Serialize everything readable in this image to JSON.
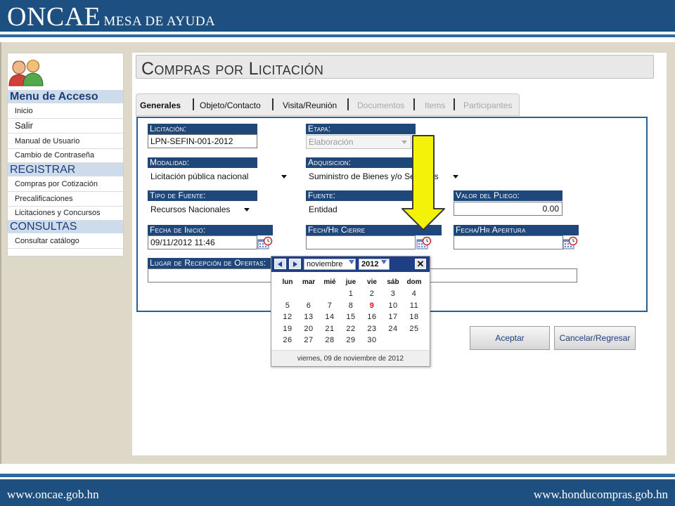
{
  "header": {
    "brand_big": "ONCAE",
    "brand_small": "MESA DE AYUDA"
  },
  "footer": {
    "url_left": "www.oncae.gob.hn",
    "url_right": "www.honducompras.gob.hn"
  },
  "menu": {
    "icon": "users-icon",
    "heading_access": "Menu de Acceso",
    "heading_register": "REGISTRAR",
    "heading_consult": "CONSULTAS",
    "items_access": [
      "Inicio",
      "Salir",
      "Manual de Usuario",
      "Cambio de Contraseña"
    ],
    "items_register": [
      "Compras por Cotización",
      "Precalificaciones",
      "Licitaciones y Concursos"
    ],
    "items_consult": [
      "Consultar catálogo"
    ]
  },
  "page": {
    "title": "Compras por Licitación"
  },
  "tabs": [
    {
      "label": "Generales",
      "state": "active"
    },
    {
      "label": "Objeto/Contacto",
      "state": "normal"
    },
    {
      "label": "Visita/Reunión",
      "state": "normal"
    },
    {
      "label": "Documentos",
      "state": "disabled"
    },
    {
      "label": "Items",
      "state": "disabled"
    },
    {
      "label": "Participantes",
      "state": "disabled"
    }
  ],
  "form": {
    "licitacion": {
      "label": "Licitación:",
      "value": "LPN-SEFIN-001-2012"
    },
    "etapa": {
      "label": "Etapa:",
      "value": "Elaboración"
    },
    "modalidad": {
      "label": "Modalidad:",
      "value": "Licitación pública nacional"
    },
    "adquisicion": {
      "label": "Adquisicion:",
      "value": "Suministro de Bienes y/o Servicios"
    },
    "tipo_fuente": {
      "label": "Tipo de Fuente:",
      "value": "Recursos Nacionales"
    },
    "fuente": {
      "label": "Fuente:",
      "value": "Entidad"
    },
    "valor_pliego": {
      "label": "Valor del Pliego:",
      "value": "0.00"
    },
    "fecha_inicio": {
      "label": "Fecha de Inicio:",
      "value": "09/11/2012 11:46"
    },
    "fech_cierre": {
      "label": "Fech/Hr Cierre",
      "value": ""
    },
    "fecha_apertura": {
      "label": "Fecha/Hr Apertura",
      "value": ""
    },
    "lugar_recepcion": {
      "label": "Lugar de Recepción de Ofertas:",
      "value": ""
    }
  },
  "buttons": {
    "accept": "Aceptar",
    "cancel": "Cancelar/Regresar"
  },
  "datepicker": {
    "month": "noviembre",
    "year": "2012",
    "close": "✕",
    "weekdays": [
      "lun",
      "mar",
      "mié",
      "jue",
      "vie",
      "sáb",
      "dom"
    ],
    "weeks": [
      [
        "",
        "",
        "",
        "1",
        "2",
        "3",
        "4"
      ],
      [
        "5",
        "6",
        "7",
        "8",
        "9",
        "10",
        "11"
      ],
      [
        "12",
        "13",
        "14",
        "15",
        "16",
        "17",
        "18"
      ],
      [
        "19",
        "20",
        "21",
        "22",
        "23",
        "24",
        "25"
      ],
      [
        "26",
        "27",
        "28",
        "29",
        "30",
        "",
        ""
      ]
    ],
    "today": "9",
    "footer": "viernes, 09 de noviembre de 2012"
  },
  "colors": {
    "header_blue": "#1d4f80",
    "label_navy": "#20477a",
    "arrow_yellow": "#f5f20a",
    "today_red": "#d11111"
  }
}
